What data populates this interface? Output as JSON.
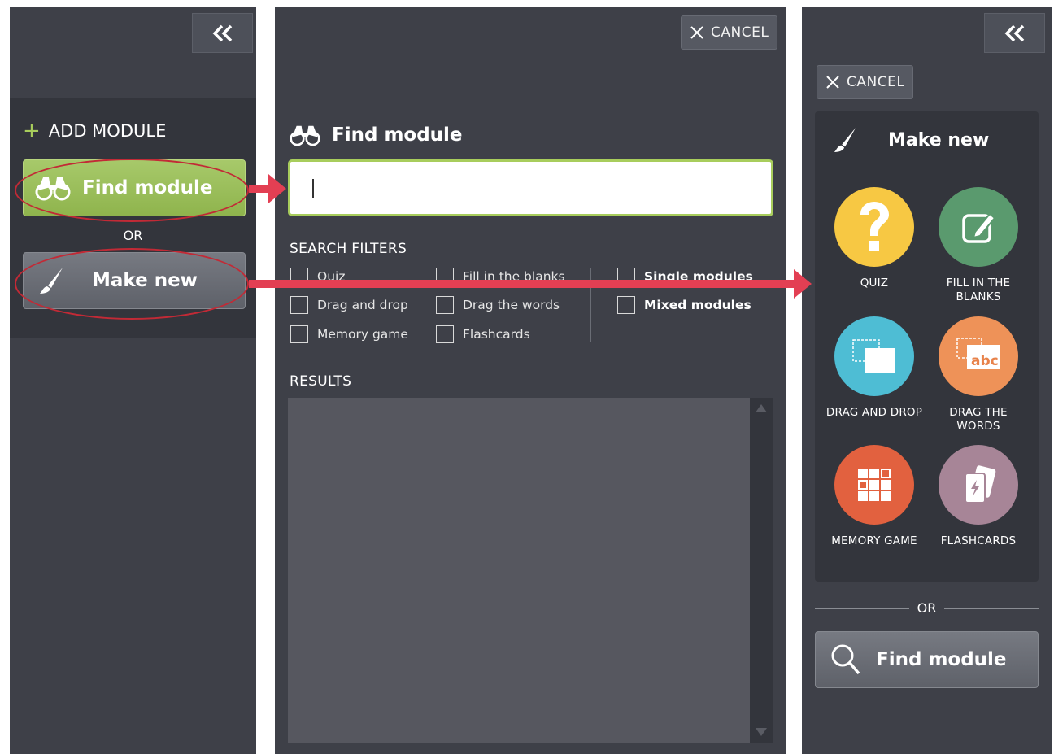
{
  "left_panel": {
    "collapse_icon": "double-chevron-left-icon",
    "add_module_label": "ADD MODULE",
    "find_module_label": "Find module",
    "or_label": "OR",
    "make_new_label": "Make new"
  },
  "middle_panel": {
    "cancel_label": "CANCEL",
    "title": "Find module",
    "search": {
      "value": "",
      "placeholder": ""
    },
    "filters_label": "SEARCH FILTERS",
    "filters": [
      {
        "label": "Quiz"
      },
      {
        "label": "Fill in the blanks"
      },
      {
        "label": "Single modules"
      },
      {
        "label": "Drag and drop"
      },
      {
        "label": "Drag the words"
      },
      {
        "label": "Mixed modules"
      },
      {
        "label": "Memory game"
      },
      {
        "label": "Flashcards"
      }
    ],
    "results_label": "RESULTS"
  },
  "right_panel": {
    "collapse_icon": "double-chevron-left-icon",
    "cancel_label": "CANCEL",
    "title": "Make new",
    "types": [
      {
        "label": "QUIZ",
        "color": "#f7c843"
      },
      {
        "label": "FILL IN THE BLANKS",
        "color": "#5a9a6e"
      },
      {
        "label": "DRAG AND DROP",
        "color": "#4ebdd4"
      },
      {
        "label": "DRAG THE WORDS",
        "color": "#ee9258"
      },
      {
        "label": "MEMORY GAME",
        "color": "#e2613f"
      },
      {
        "label": "FLASHCARDS",
        "color": "#a78597"
      }
    ],
    "or_label": "OR",
    "find_module_label": "Find module",
    "type_icon_text": {
      "drag_the_words": "abc"
    }
  },
  "colors": {
    "panel_bg": "#3e4048",
    "accent_green": "#a8cd5c",
    "annotation_red": "#e33f53"
  }
}
